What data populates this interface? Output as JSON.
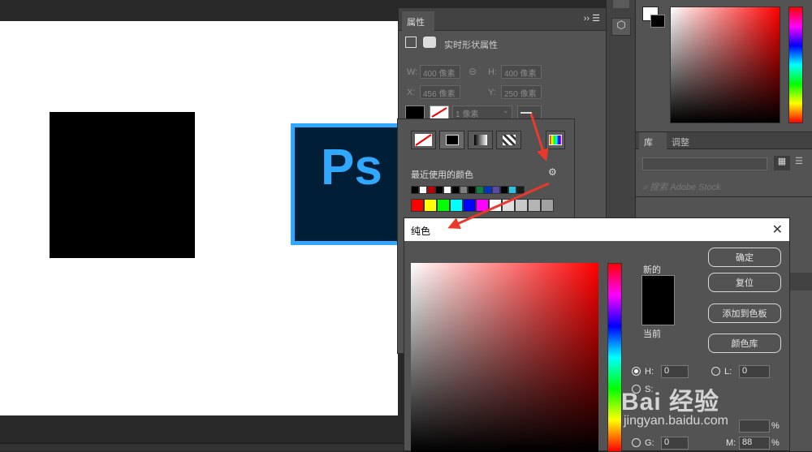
{
  "properties_panel": {
    "tab_label": "属性",
    "menu_glyph": "›› ☰",
    "section_title": "实时形状属性",
    "w_label": "W:",
    "w_value": "400 像素",
    "h_label": "H:",
    "h_value": "400 像素",
    "x_label": "X:",
    "x_value": "456 像素",
    "y_label": "Y:",
    "y_value": "250 像素",
    "stroke_width": "1 像素"
  },
  "fill_picker": {
    "recent_colors_label": "最近使用的颜色",
    "recent_colors": [
      "#000000",
      "#ffffff",
      "#c00000",
      "#000000",
      "#ffffff",
      "#000000",
      "#7f7f7f",
      "#000000",
      "#0c8040",
      "#0033cc",
      "#5a4aa8",
      "#000000",
      "#2ec2e0",
      "#1a1a1a"
    ],
    "swatches": [
      "#ff0000",
      "#ffff00",
      "#00ff00",
      "#00ffff",
      "#0000ff",
      "#ff00ff",
      "#ffffff",
      "#e0e0e0",
      "#c8c8c8",
      "#b4b4b4",
      "#a0a0a0"
    ]
  },
  "canvas": {
    "logo_text": "Ps"
  },
  "color_dialog": {
    "title": "纯色",
    "close_glyph": "✕",
    "new_label": "新的",
    "current_label": "当前",
    "new_color": "#000000",
    "buttons": {
      "ok": "确定",
      "reset": "复位",
      "add_to_swatches": "添加到色板",
      "color_libraries": "颜色库"
    },
    "fields": {
      "h_label": "H:",
      "h_value": "0",
      "s_label": "S:",
      "l_label": "L:",
      "l_value": "0",
      "g_label": "G:",
      "g_value": "0",
      "m_label": "M:",
      "m_value": "88",
      "percent": "%"
    }
  },
  "right_dock": {
    "tab_library": "库",
    "tab_adjust": "调整",
    "search_placeholder": "搜索 Adobe Stock"
  },
  "watermark": {
    "brand": "Bai 经验",
    "url": "jingyan.baidu.com"
  },
  "colors": {
    "accent_arrow": "#e8392c",
    "ps_blue": "#31a8ff",
    "ps_dark": "#001e36"
  }
}
